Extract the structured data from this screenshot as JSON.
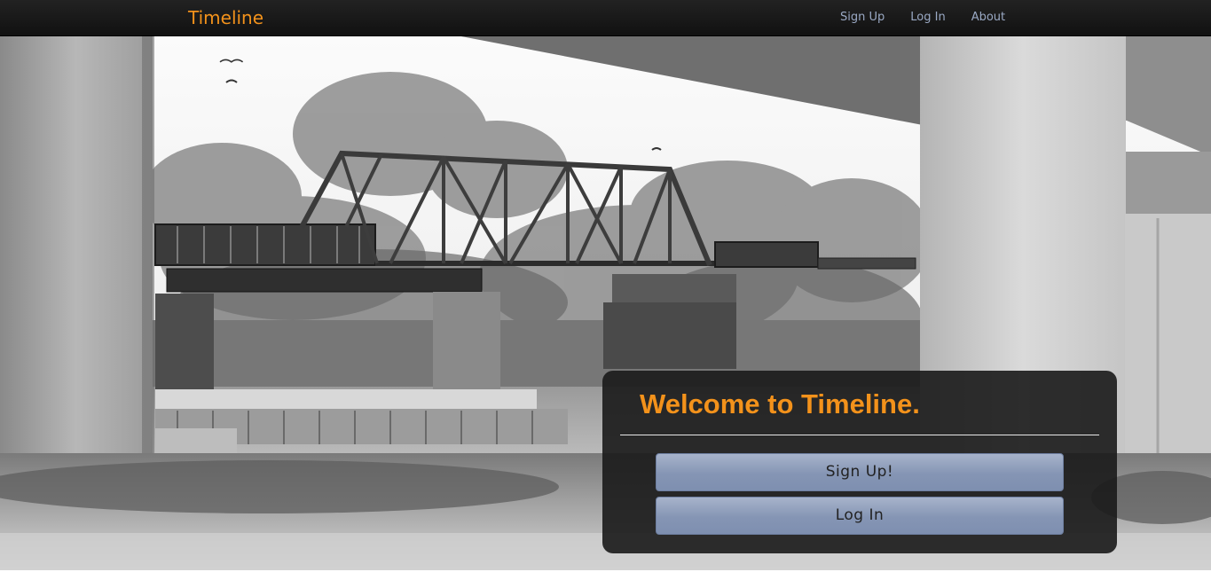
{
  "navbar": {
    "brand": "Timeline",
    "links": [
      {
        "label": "Sign Up"
      },
      {
        "label": "Log In"
      },
      {
        "label": "About"
      }
    ]
  },
  "hero": {
    "image_description": "grayscale-photo-railway-bridge-under-highway"
  },
  "welcome": {
    "title": "Welcome to Timeline.",
    "signup_label": "Sign Up!",
    "login_label": "Log In"
  },
  "colors": {
    "accent": "#f3921b",
    "navbar_bg": "#1a1a1a",
    "nav_link": "#9aa9c4",
    "button_fill": "#8a99b8",
    "panel_bg": "#191919"
  }
}
